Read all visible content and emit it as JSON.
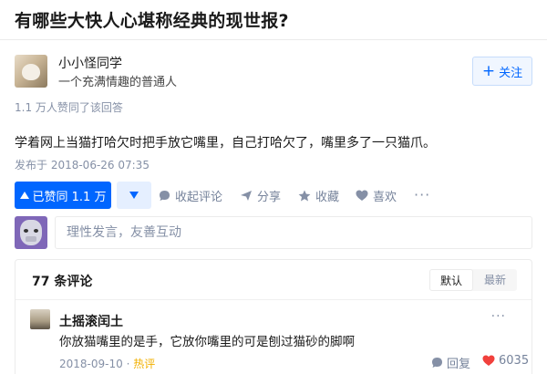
{
  "question": {
    "title": "有哪些大快人心堪称经典的现世报?"
  },
  "author": {
    "name": "小小怪同学",
    "bio": "一个充满情趣的普通人",
    "follow_label": "关注"
  },
  "answer": {
    "votes_text": "1.1 万人赞同了该回答",
    "content": "学着网上当猫打哈欠时把手放它嘴里，自己打哈欠了，嘴里多了一只猫爪。",
    "published": "发布于 2018-06-26 07:35"
  },
  "actions": {
    "agree_label": "已赞同 1.1 万",
    "collapse_label": "收起评论",
    "share_label": "分享",
    "collect_label": "收藏",
    "like_label": "喜欢",
    "more_label": "···"
  },
  "comment_input": {
    "placeholder": "理性发言，友善互动"
  },
  "comments": {
    "count_label": "77 条评论",
    "sort_default": "默认",
    "sort_latest": "最新",
    "items": [
      {
        "author": "土摇滚闰土",
        "text": "你放猫嘴里的是手，它放你嘴里的可是刨过猫砂的脚啊",
        "date": "2018-09-10",
        "hot": "热评",
        "reply_label": "回复",
        "likes": "6035"
      }
    ]
  },
  "colors": {
    "brand": "#0066ff",
    "muted": "#8590a6",
    "like": "#f1403c",
    "hot": "#f1b000"
  }
}
